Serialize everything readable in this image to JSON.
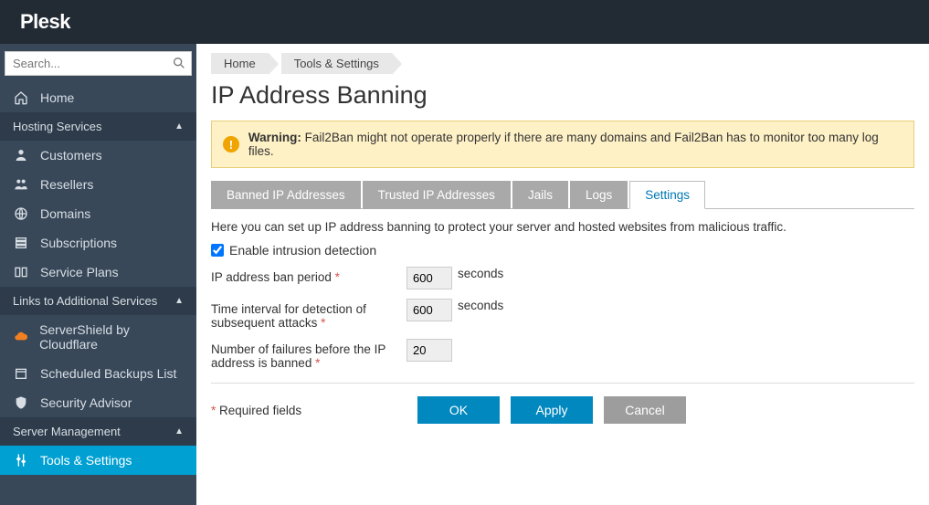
{
  "brand": "Plesk",
  "search": {
    "placeholder": "Search..."
  },
  "sidebar": {
    "home": "Home",
    "sections": {
      "hosting": "Hosting Services",
      "links": "Links to Additional Services",
      "server": "Server Management"
    },
    "hosting_items": [
      "Customers",
      "Resellers",
      "Domains",
      "Subscriptions",
      "Service Plans"
    ],
    "links_items": [
      "ServerShield by Cloudflare",
      "Scheduled Backups List",
      "Security Advisor"
    ],
    "server_items": [
      "Tools & Settings"
    ]
  },
  "breadcrumbs": [
    "Home",
    "Tools & Settings"
  ],
  "page_title": "IP Address Banning",
  "warning": {
    "label": "Warning:",
    "text": "Fail2Ban might not operate properly if there are many domains and Fail2Ban has to monitor too many log files."
  },
  "tabs": [
    "Banned IP Addresses",
    "Trusted IP Addresses",
    "Jails",
    "Logs",
    "Settings"
  ],
  "active_tab": "Settings",
  "description": "Here you can set up IP address banning to protect your server and hosted websites from malicious traffic.",
  "checkbox_label": "Enable intrusion detection",
  "checkbox_checked": true,
  "fields": {
    "ban_period": {
      "label": "IP address ban period",
      "value": "600",
      "suffix": "seconds"
    },
    "time_interval": {
      "label": "Time interval for detection of subsequent attacks",
      "value": "600",
      "suffix": "seconds"
    },
    "failures": {
      "label": "Number of failures before the IP address is banned",
      "value": "20",
      "suffix": ""
    }
  },
  "required_note": "Required fields",
  "buttons": {
    "ok": "OK",
    "apply": "Apply",
    "cancel": "Cancel"
  }
}
